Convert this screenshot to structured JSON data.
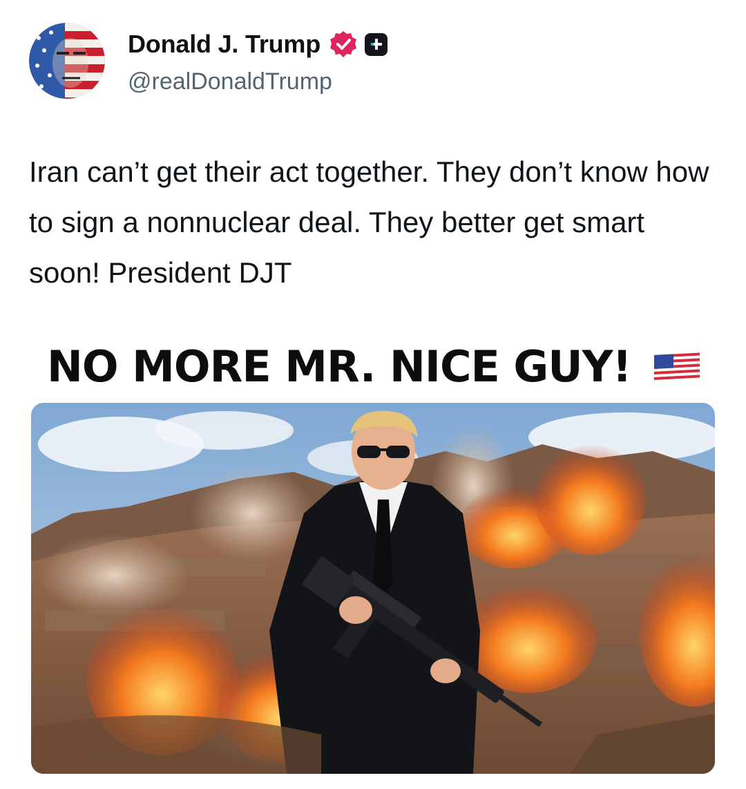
{
  "post": {
    "author_name": "Donald J. Trump",
    "handle": "@realDonaldTrump",
    "verified_icon": "verified-badge-icon",
    "plus_icon": "plus-badge-icon",
    "text": "Iran can’t get their act together. They don’t know how to sign a nonnuclear deal. They better get smart soon! President DJT"
  },
  "meme": {
    "title": "NO MORE MR. NICE GUY!",
    "flag_icon": "us-flag-icon"
  },
  "colors": {
    "verified": "#e0245e",
    "handle": "#536471",
    "text": "#0f1419"
  }
}
